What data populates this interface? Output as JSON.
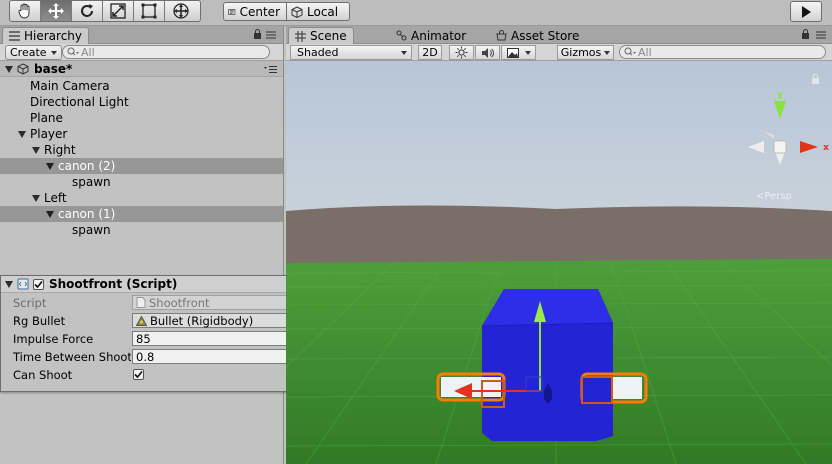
{
  "toolbar": {
    "tools": [
      "hand-tool-icon",
      "move-tool-icon",
      "rotate-tool-icon",
      "scale-tool-icon",
      "rect-tool-icon",
      "transform-tool-icon"
    ],
    "pivot_mode": "Center",
    "pivot_rotation": "Local"
  },
  "hierarchy": {
    "tab_label": "Hierarchy",
    "create_label": "Create",
    "search_placeholder": "All",
    "scene_name": "base*",
    "items": [
      {
        "label": "Main Camera"
      },
      {
        "label": "Directional Light"
      },
      {
        "label": "Plane"
      },
      {
        "label": "Player"
      },
      {
        "label": "Right"
      },
      {
        "label": "canon (2)"
      },
      {
        "label": "spawn"
      },
      {
        "label": "Left"
      },
      {
        "label": "canon (1)"
      },
      {
        "label": "spawn"
      }
    ]
  },
  "inspector": {
    "component_title": "Shootfront (Script)",
    "properties": [
      {
        "label": "Script",
        "value": "Shootfront"
      },
      {
        "label": "Rg Bullet",
        "value": "Bullet (Rigidbody)"
      },
      {
        "label": "Impulse Force",
        "value": "85"
      },
      {
        "label": "Time Between Shoot",
        "value": "0.8"
      },
      {
        "label": "Can Shoot",
        "value": "true"
      }
    ]
  },
  "scene_tabs": [
    {
      "label": "Scene"
    },
    {
      "label": "Animator"
    },
    {
      "label": "Asset Store"
    }
  ],
  "scene_toolbar": {
    "shading": "Shaded",
    "mode_2d": "2D",
    "gizmos": "Gizmos",
    "search_placeholder": "All"
  },
  "gizmo": {
    "axis_y": "y",
    "axis_x": "x",
    "projection": "Persp"
  },
  "colors": {
    "cube": "#2b2bd6",
    "ground": "#3f8f31",
    "sky": "#b9c7d6",
    "selection_outline": "#ff7a00",
    "axis_x": "#e0341e",
    "axis_y": "#8be23b"
  }
}
